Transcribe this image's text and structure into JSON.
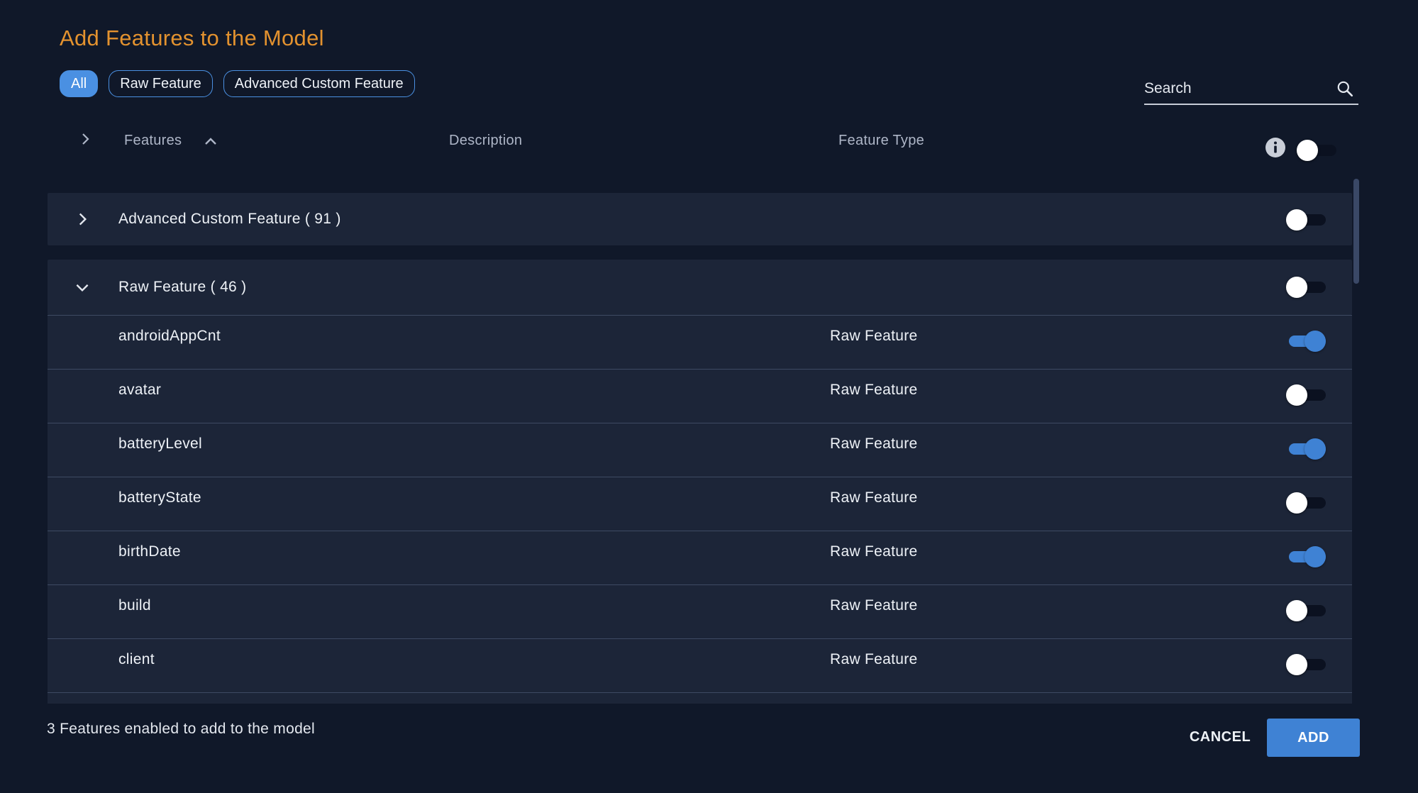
{
  "dialog": {
    "title": "Add Features to the Model"
  },
  "filters": [
    {
      "label": "All",
      "active": true
    },
    {
      "label": "Raw Feature",
      "active": false
    },
    {
      "label": "Advanced Custom Feature",
      "active": false
    }
  ],
  "search": {
    "placeholder": "Search",
    "value": "",
    "icon": "search-icon"
  },
  "table": {
    "columns": {
      "features": "Features",
      "description": "Description",
      "feature_type": "Feature Type"
    },
    "sort": {
      "column": "Features",
      "direction": "ascending"
    },
    "select_all_enabled": false,
    "groups": [
      {
        "label": "Advanced Custom Feature ( 91 )",
        "expanded": false,
        "enabled": false
      },
      {
        "label": "Raw Feature ( 46 )",
        "expanded": true,
        "enabled": false
      }
    ],
    "rows": [
      {
        "name": "androidAppCnt",
        "description": "",
        "type": "Raw Feature",
        "enabled": true
      },
      {
        "name": "avatar",
        "description": "",
        "type": "Raw Feature",
        "enabled": false
      },
      {
        "name": "batteryLevel",
        "description": "",
        "type": "Raw Feature",
        "enabled": true
      },
      {
        "name": "batteryState",
        "description": "",
        "type": "Raw Feature",
        "enabled": false
      },
      {
        "name": "birthDate",
        "description": "",
        "type": "Raw Feature",
        "enabled": true
      },
      {
        "name": "build",
        "description": "",
        "type": "Raw Feature",
        "enabled": false
      },
      {
        "name": "client",
        "description": "",
        "type": "Raw Feature",
        "enabled": false
      }
    ]
  },
  "footer": {
    "status": "3 Features enabled to add to the model",
    "cancel_label": "CANCEL",
    "add_label": "ADD"
  },
  "colors": {
    "background": "#101829",
    "panel": "#1c2538",
    "accent": "#3f82d4",
    "title": "#e3922f"
  }
}
